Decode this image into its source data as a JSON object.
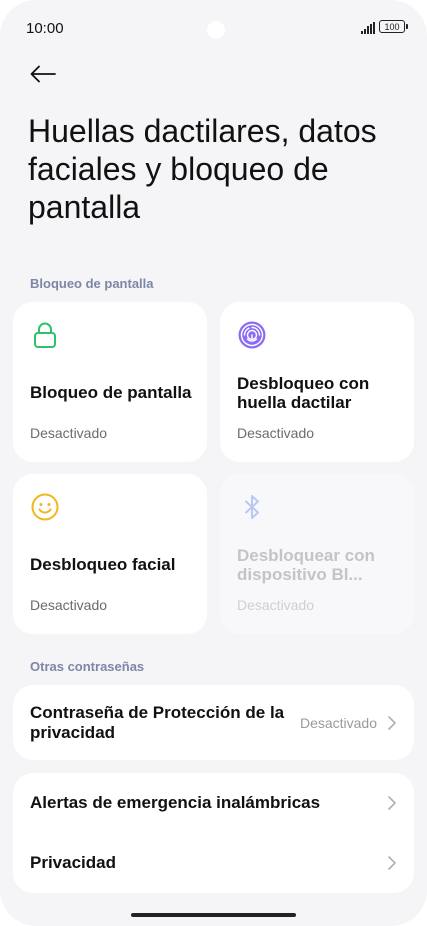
{
  "status": {
    "time": "10:00",
    "battery": "100"
  },
  "page": {
    "title": "Huellas dactilares, datos faciales y bloqueo de pantalla"
  },
  "section_lock": {
    "label": "Bloqueo de pantalla"
  },
  "cards": [
    {
      "title": "Bloqueo de pantalla",
      "status": "Desactivado",
      "icon": "lock-icon",
      "color": "#2ec26a"
    },
    {
      "title": "Desbloqueo con huella dactilar",
      "status": "Desactivado",
      "icon": "fingerprint-icon",
      "color": "#7a5cf0"
    },
    {
      "title": "Desbloqueo facial",
      "status": "Desactivado",
      "icon": "face-icon",
      "color": "#f2b61c"
    },
    {
      "title": "Desbloquear con dispositivo Bl...",
      "status": "Desactivado",
      "icon": "bluetooth-icon",
      "color": "#b9c9f2"
    }
  ],
  "section_other": {
    "label": "Otras contraseñas"
  },
  "privacy_password": {
    "label": "Contraseña de Protección de la privacidad",
    "value": "Desactivado"
  },
  "list2": [
    {
      "label": "Alertas de emergencia inalámbricas"
    },
    {
      "label": "Privacidad"
    }
  ]
}
